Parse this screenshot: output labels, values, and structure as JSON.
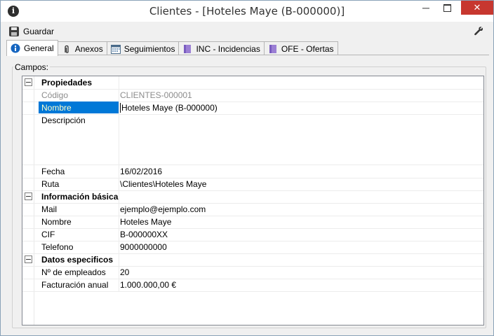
{
  "window": {
    "title": "Clientes - [Hoteles Maye (B-000000)]",
    "icon": "info-icon",
    "minimize_label": "─",
    "close_label": "✕"
  },
  "toolbar": {
    "save_label": "Guardar",
    "save_icon": "floppy-disk-icon",
    "settings_icon": "wrench-icon"
  },
  "tabs": [
    {
      "label": "General",
      "icon": "info-icon",
      "active": true
    },
    {
      "label": "Anexos",
      "icon": "paperclip-icon"
    },
    {
      "label": "Seguimientos",
      "icon": "calendar-icon"
    },
    {
      "label": "INC - Incidencias",
      "icon": "binder-icon"
    },
    {
      "label": "OFE - Ofertas",
      "icon": "binder-icon"
    }
  ],
  "group": {
    "label": "Campos:"
  },
  "grid": {
    "categories": [
      {
        "name": "Propiedades",
        "rows": [
          {
            "label": "Código",
            "value": "CLIENTES-000001",
            "readonly": true
          },
          {
            "label": "Nombre",
            "value": "Hoteles Maye (B-000000)",
            "selected": true
          },
          {
            "label": "Descripción",
            "value": ""
          },
          {
            "label": "Fecha",
            "value": "16/02/2016"
          },
          {
            "label": "Ruta",
            "value": "\\Clientes\\Hoteles Maye"
          }
        ]
      },
      {
        "name": "Información básica",
        "rows": [
          {
            "label": "Mail",
            "value": "ejemplo@ejemplo.com"
          },
          {
            "label": "Nombre",
            "value": "Hoteles Maye"
          },
          {
            "label": "CIF",
            "value": "B-000000XX"
          },
          {
            "label": "Telefono",
            "value": "9000000000"
          }
        ]
      },
      {
        "name": "Datos especificos",
        "rows": [
          {
            "label": "Nº de empleados",
            "value": "20"
          },
          {
            "label": "Facturación anual",
            "value": "1.000.000,00 €"
          }
        ]
      }
    ]
  },
  "colors": {
    "selection": "#0078d7",
    "selection_text": "#ffffcc",
    "close_button": "#c7372f",
    "readonly_text": "#8c8c8c"
  }
}
